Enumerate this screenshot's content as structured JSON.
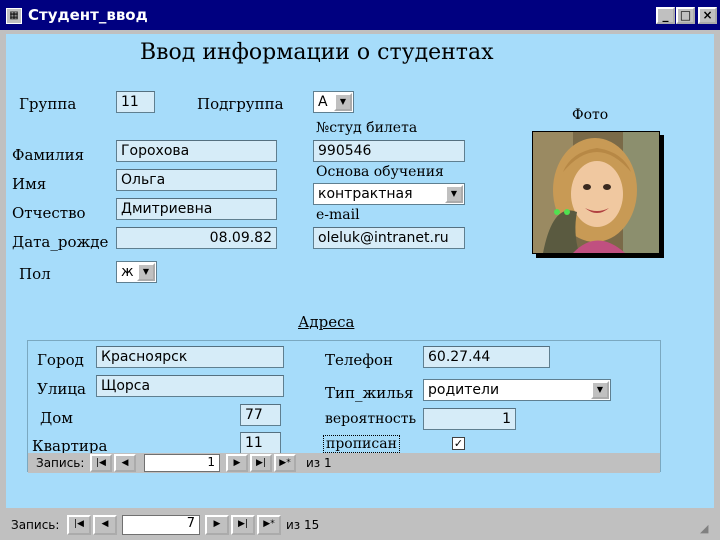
{
  "window": {
    "title": "Студент_ввод",
    "minimize": "_",
    "maximize": "□",
    "close": "×"
  },
  "form_title": "Ввод информации о студентах",
  "fields": {
    "group": {
      "label": "Группа",
      "value": "11"
    },
    "subgroup": {
      "label": "Подгруппа",
      "value": "А"
    },
    "student_card": {
      "label": "№студ  билета",
      "value": "990546"
    },
    "surname": {
      "label": "Фамилия",
      "value": "Горохова"
    },
    "name": {
      "label": "Имя",
      "value": "Ольга"
    },
    "patronymic": {
      "label": "Отчество",
      "value": "Дмитриевна"
    },
    "birth_date": {
      "label": "Дата_рожде",
      "value": "08.09.82"
    },
    "study_basis": {
      "label": "Основа обучения",
      "value": "контрактная"
    },
    "email": {
      "label": "e-mail",
      "value": "oleluk@intranet.ru"
    },
    "sex": {
      "label": "Пол",
      "value": "ж"
    }
  },
  "photo": {
    "label": "Фото"
  },
  "address": {
    "title": "Адреса",
    "city": {
      "label": "Город",
      "value": "Красноярск"
    },
    "street": {
      "label": "Улица",
      "value": "Щорса"
    },
    "house": {
      "label": "Дом",
      "value": "77"
    },
    "apartment": {
      "label": "Квартира",
      "value": "11"
    },
    "phone": {
      "label": "Телефон",
      "value": "60.27.44"
    },
    "housing_type": {
      "label": "Тип_жилья",
      "value": "родители"
    },
    "probability": {
      "label": "вероятность",
      "value": "1"
    },
    "registered": {
      "label": "прописан",
      "checked": true
    }
  },
  "subform_nav": {
    "label": "Запись:",
    "current": "1",
    "of_text": "из  1"
  },
  "main_nav": {
    "label": "Запись:",
    "current": "7",
    "of_text": "из  15"
  },
  "colors": {
    "form_bg": "#a6dcfa",
    "titlebar": "#000080",
    "chrome": "#c0c0c0"
  }
}
